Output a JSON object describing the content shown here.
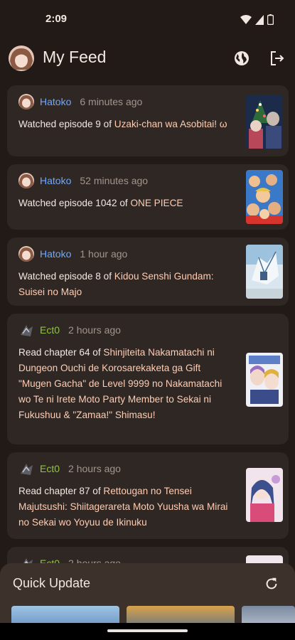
{
  "status_bar": {
    "time": "2:09"
  },
  "header": {
    "title": "My Feed",
    "icons": [
      "globe-icon",
      "logout-icon"
    ]
  },
  "feed": [
    {
      "user": "Hatoko",
      "user_color": "#6ea8ff",
      "time": "6 minutes ago",
      "prefix": "Watched episode 9 of ",
      "title": "Uzaki-chan wa Asobitai! ω"
    },
    {
      "user": "Hatoko",
      "user_color": "#6ea8ff",
      "time": "52 minutes ago",
      "prefix": "Watched episode 1042 of ",
      "title": "ONE PIECE"
    },
    {
      "user": "Hatoko",
      "user_color": "#6ea8ff",
      "time": "1 hour ago",
      "prefix": "Watched episode 8 of ",
      "title": "Kidou Senshi Gundam: Suisei no Majo"
    },
    {
      "user": "Ect0",
      "user_color": "#8dc63f",
      "time": "2 hours ago",
      "prefix": "Read chapter 64 of ",
      "title": "Shinjiteita Nakamatachi ni Dungeon Ouchi de Korosarekaketa ga Gift \"Mugen Gacha\" de Level 9999 no Nakamatachi wo Te ni Irete Moto Party Member to Sekai ni Fukushuu & \"Zamaa!\" Shimasu!"
    },
    {
      "user": "Ect0",
      "user_color": "#8dc63f",
      "time": "2 hours ago",
      "prefix": "Read chapter 87 of ",
      "title": "Rettougan no Tensei Majutsushi: Shiitagerareta Moto Yuusha wa Mirai no Sekai wo Yoyuu de Ikinuku"
    },
    {
      "user": "Ect0",
      "user_color": "#8dc63f",
      "time": "2 hours ago",
      "prefix": "",
      "title": ""
    }
  ],
  "quick_update": {
    "title": "Quick Update",
    "refresh_icon": "refresh-icon"
  }
}
